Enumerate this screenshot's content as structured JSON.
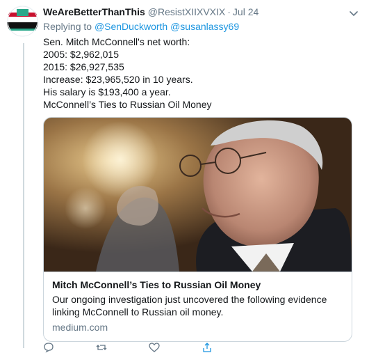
{
  "tweet": {
    "display_name": "WeAreBetterThanThis",
    "handle": "@ResistXIIXVXIX",
    "separator": "·",
    "time": "Jul 24",
    "replying_prefix": "Replying to",
    "replying_to": [
      "@SenDuckworth",
      "@susanlassy69"
    ],
    "lines": [
      "Sen. Mitch McConnell's net worth:",
      "2005: $2,962,015",
      "2015: $26,927,535",
      "Increase: $23,965,520 in 10 years.",
      "His salary is $193,400 a year.",
      "McConnell’s Ties to Russian Oil Money"
    ]
  },
  "card": {
    "title": "Mitch McConnell’s Ties to Russian Oil Money",
    "description": "Our ongoing investigation just uncovered the following evidence linking McConnell to Russian oil money.",
    "domain": "medium.com"
  },
  "icons": {
    "avatar": "american-flag-style-logo-icon",
    "menu": "chevron-down-icon",
    "reply": "reply-icon",
    "retweet": "retweet-icon",
    "like": "heart-icon",
    "share": "share-icon"
  },
  "colors": {
    "link": "#1b95e0",
    "secondary_text": "#657786",
    "border": "#ccd6dd"
  }
}
